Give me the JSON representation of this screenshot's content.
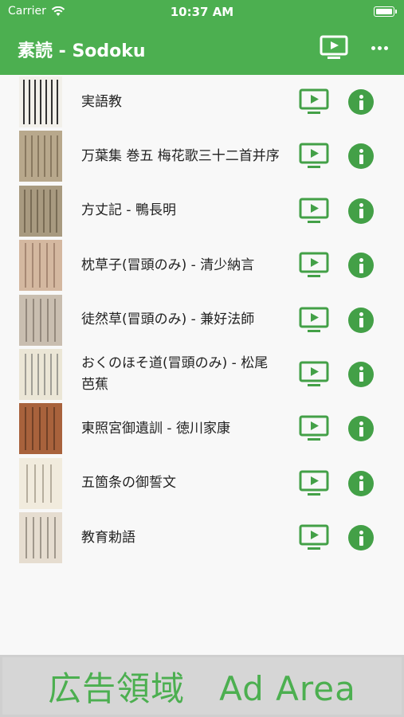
{
  "status_bar": {
    "carrier": "Carrier",
    "time": "10:37 AM"
  },
  "nav": {
    "title": "素読 - Sodoku",
    "play_icon": "tv-play-icon",
    "more_icon": "more-horizontal-icon"
  },
  "colors": {
    "brand": "#4caf50",
    "icon_green": "#43a047"
  },
  "items": [
    {
      "title": "実語教"
    },
    {
      "title": "万葉集 巻五 梅花歌三十二首并序"
    },
    {
      "title": "方丈記 - 鴨長明"
    },
    {
      "title": "枕草子(冒頭のみ) - 清少納言"
    },
    {
      "title": "徒然草(冒頭のみ) - 兼好法師"
    },
    {
      "title": "おくのほそ道(冒頭のみ) - 松尾芭蕉"
    },
    {
      "title": "東照宮御遺訓 - 徳川家康"
    },
    {
      "title": "五箇条の御誓文"
    },
    {
      "title": "教育勅語"
    }
  ],
  "ad": {
    "label": "広告領域　Ad Area"
  }
}
